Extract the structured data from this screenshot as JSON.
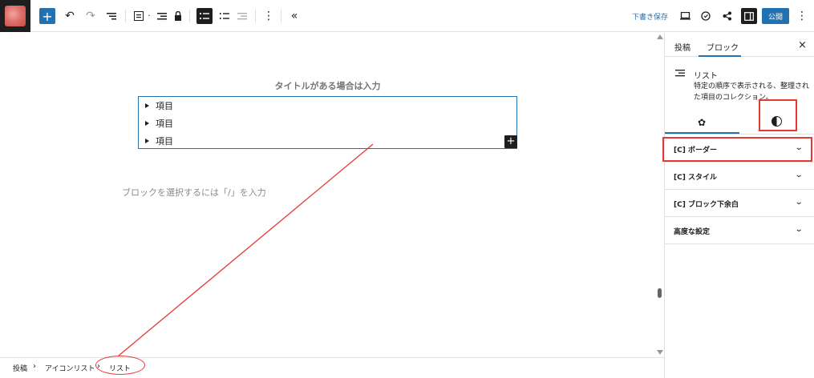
{
  "toolbar": {
    "draft_save": "下書き保存",
    "publish": "公開"
  },
  "editor": {
    "title_placeholder": "タイトルがある場合は入力",
    "list_items": [
      "項目",
      "項目",
      "項目"
    ],
    "block_placeholder": "ブロックを選択するには「/」を入力"
  },
  "sidebar": {
    "tabs": [
      "投稿",
      "ブロック"
    ],
    "block": {
      "name": "リスト",
      "description": "特定の順序で表示される、整理された項目のコレクション。"
    },
    "sections": [
      "[C] ボーダー",
      "[C] スタイル",
      "[C] ブロック下余白",
      "高度な設定"
    ]
  },
  "breadcrumb": [
    "投稿",
    "アイコンリスト",
    "リスト"
  ],
  "colors": {
    "accent": "#2271b1",
    "annotation": "#e53935"
  }
}
